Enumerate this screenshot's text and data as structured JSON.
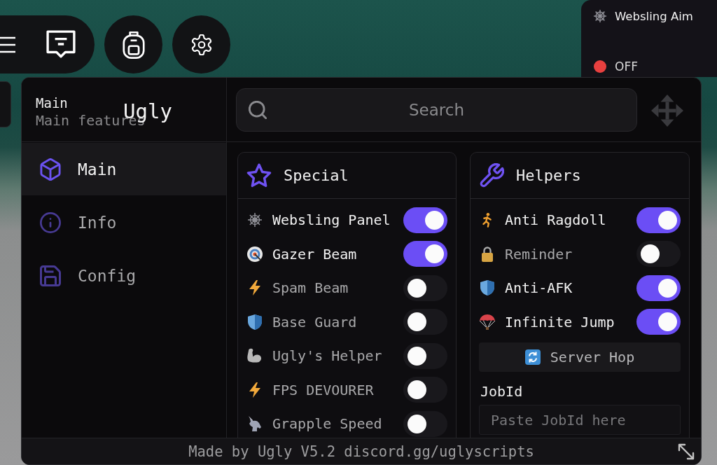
{
  "aim_indicator": {
    "title": "Websling Aim",
    "status": "OFF",
    "active": false
  },
  "window": {
    "title": "Ugly"
  },
  "page_header": {
    "title": "Main",
    "subtitle": "Main features"
  },
  "sidebar": {
    "items": [
      {
        "label": "Main",
        "selected": true
      },
      {
        "label": "Info",
        "selected": false
      },
      {
        "label": "Config",
        "selected": false
      }
    ]
  },
  "search": {
    "placeholder": "Search"
  },
  "sections": [
    {
      "title": "Special",
      "items": [
        {
          "kind": "toggle",
          "label": "Websling Panel",
          "on": true
        },
        {
          "kind": "toggle",
          "label": "Gazer Beam",
          "on": true
        },
        {
          "kind": "toggle",
          "label": "Spam Beam",
          "on": false
        },
        {
          "kind": "toggle",
          "label": "Base Guard",
          "on": false
        },
        {
          "kind": "toggle",
          "label": "Ugly's Helper",
          "on": false
        },
        {
          "kind": "toggle",
          "label": "FPS DEVOURER",
          "on": false
        },
        {
          "kind": "toggle",
          "label": "Grapple Speed",
          "on": false
        }
      ]
    },
    {
      "title": "Helpers",
      "items": [
        {
          "kind": "toggle",
          "label": "Anti Ragdoll",
          "on": true
        },
        {
          "kind": "toggle",
          "label": "Reminder",
          "on": false
        },
        {
          "kind": "toggle",
          "label": "Anti-AFK",
          "on": true
        },
        {
          "kind": "toggle",
          "label": "Infinite Jump",
          "on": true
        },
        {
          "kind": "button",
          "label": "Server Hop"
        },
        {
          "kind": "input",
          "label": "JobId",
          "placeholder": "Paste JobId here"
        }
      ]
    }
  ],
  "footer": {
    "text": "Made by Ugly V5.2 discord.gg/uglyscripts"
  }
}
